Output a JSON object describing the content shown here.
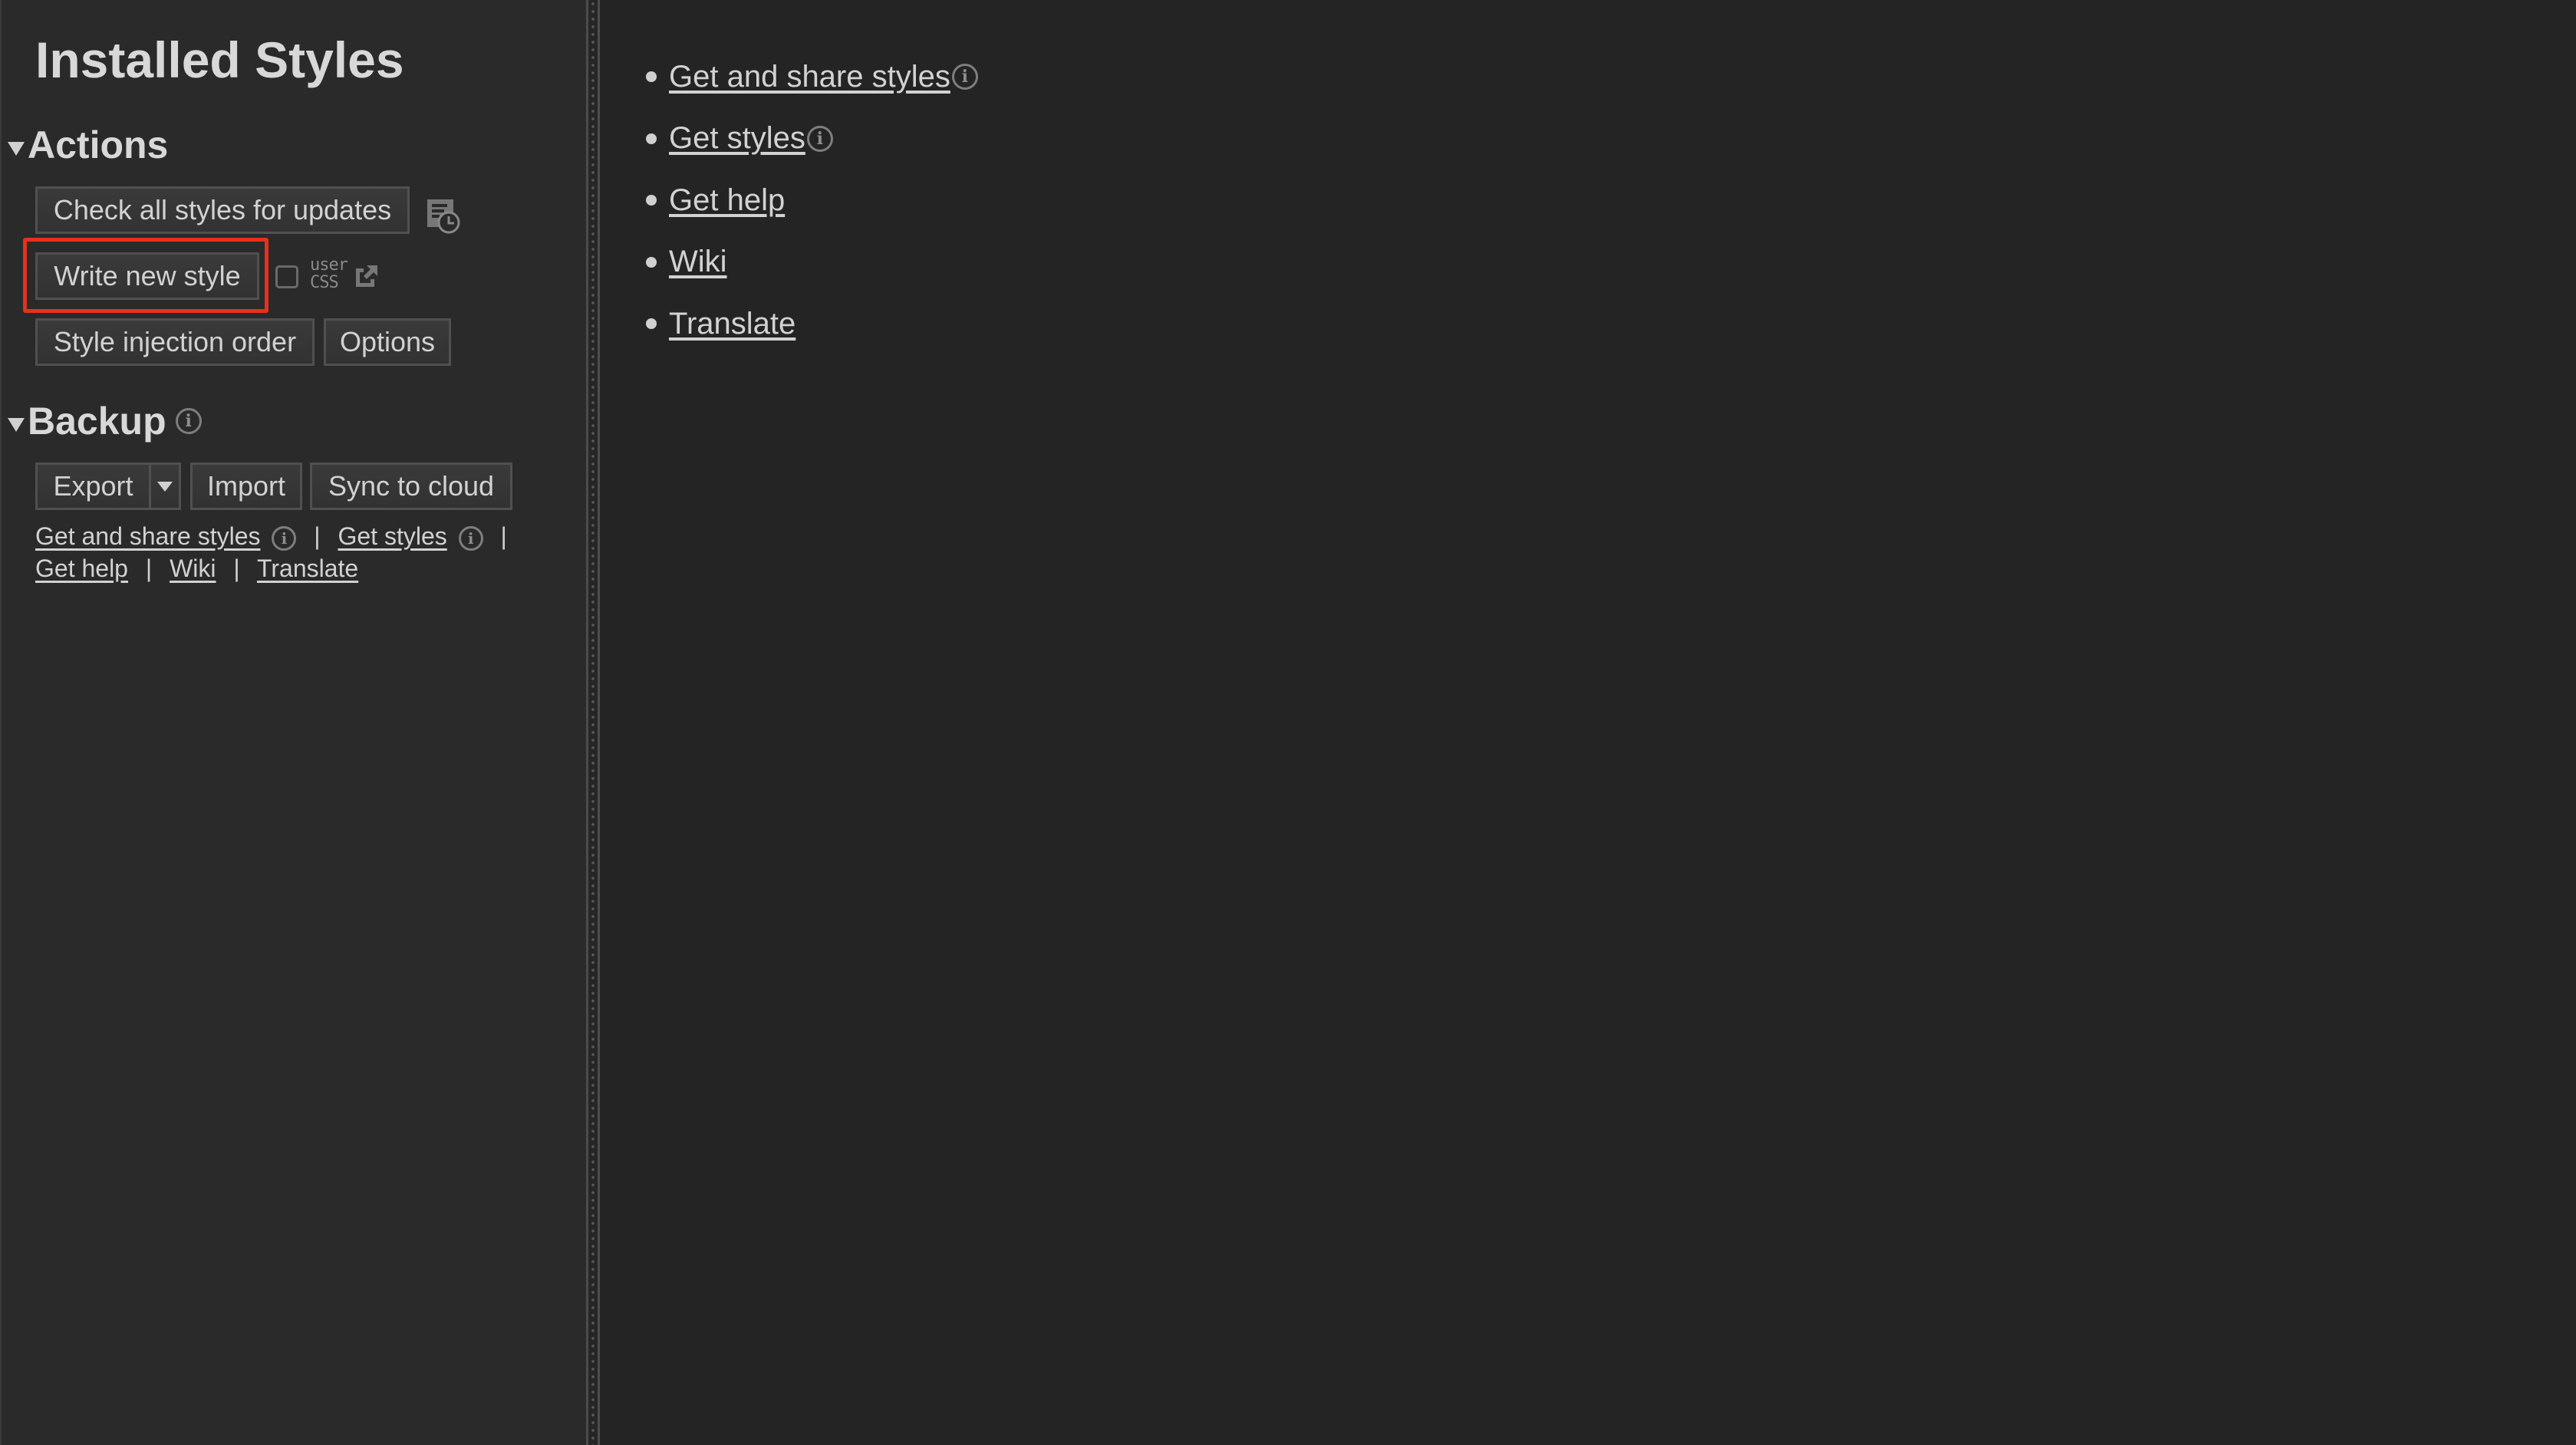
{
  "sidebar": {
    "title": "Installed Styles",
    "actions": {
      "heading": "Actions",
      "check_updates": "Check all styles for updates",
      "write_new": "Write new style",
      "usercss_line1": "user",
      "usercss_line2": "CSS",
      "injection_order": "Style injection order",
      "options": "Options"
    },
    "backup": {
      "heading": "Backup",
      "export": "Export",
      "import": "Import",
      "sync": "Sync to cloud"
    },
    "links": {
      "get_share": "Get and share styles",
      "get_styles": "Get styles",
      "get_help": "Get help",
      "wiki": "Wiki",
      "translate": "Translate",
      "separator": "|"
    }
  },
  "main": {
    "links": [
      {
        "label": "Get and share styles",
        "info": true
      },
      {
        "label": "Get styles",
        "info": true
      },
      {
        "label": "Get help",
        "info": false
      },
      {
        "label": "Wiki",
        "info": false
      },
      {
        "label": "Translate",
        "info": false
      }
    ]
  },
  "icons": {
    "info": "i"
  },
  "colors": {
    "highlight": "#e8301c",
    "background": "#242424",
    "sidebar": "#2a2a2a"
  }
}
